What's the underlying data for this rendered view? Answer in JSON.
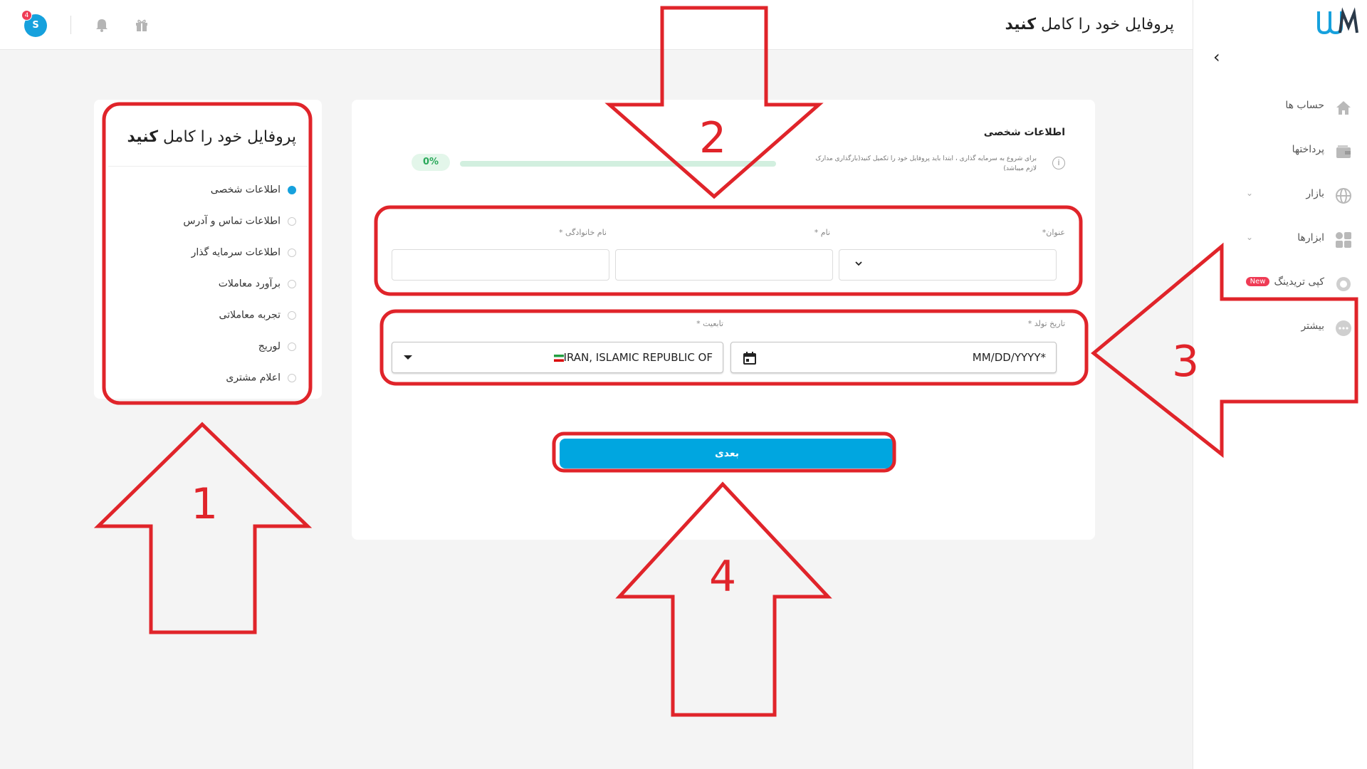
{
  "topbar": {
    "title_regular": "پروفایل خود را کامل ",
    "title_bold": "کنید",
    "avatar_letter": "S",
    "notification_count": "4"
  },
  "sidebar": {
    "items": [
      {
        "label": "حساب ها",
        "icon": "home-icon",
        "has_chevron": false
      },
      {
        "label": "پرداختها",
        "icon": "wallet-icon",
        "has_chevron": false
      },
      {
        "label": "بازار",
        "icon": "globe-icon",
        "has_chevron": true
      },
      {
        "label": "ابزارها",
        "icon": "apps-icon",
        "has_chevron": true
      },
      {
        "label": "کپی تریدینگ",
        "icon": "copy-trading-icon",
        "has_chevron": false,
        "badge": "New"
      },
      {
        "label": "بیشتر",
        "icon": "more-icon",
        "has_chevron": false
      }
    ]
  },
  "steps": {
    "title_regular": "پروفایل خود را کامل ",
    "title_bold": "کنید",
    "items": [
      {
        "label": "اطلاعات شخصی",
        "active": true
      },
      {
        "label": "اطلاعات تماس و آدرس",
        "active": false
      },
      {
        "label": "اطلاعات سرمایه گذار",
        "active": false
      },
      {
        "label": "برآورد معاملات",
        "active": false
      },
      {
        "label": "تجربه معاملاتی",
        "active": false
      },
      {
        "label": "لوریج",
        "active": false
      },
      {
        "label": "اعلام مشتری",
        "active": false
      }
    ]
  },
  "form": {
    "section_title": "اطلاعات شخصی",
    "info_text": "برای شروع به سرمایه گذاری ، ابتدا باید پروفایل خود را تکمیل کنید(بارگذاری مدارک لازم میباشد)",
    "progress_percent": 0,
    "progress_label": "0%",
    "title_label": "عنوان*",
    "title_value": "",
    "first_name_label": "نام *",
    "first_name_value": "",
    "last_name_label": "نام خانوادگی *",
    "last_name_value": "",
    "birth_label": "تاریخ تولد *",
    "birth_placeholder": "MM/DD/YYYY*",
    "nationality_label": "تابعیت *",
    "nationality_value": "IRAN, ISLAMIC REPUBLIC OF",
    "next_button": "بعدی"
  },
  "annotations": {
    "labels": [
      "1",
      "2",
      "3",
      "4"
    ],
    "color": "#e0242a"
  }
}
